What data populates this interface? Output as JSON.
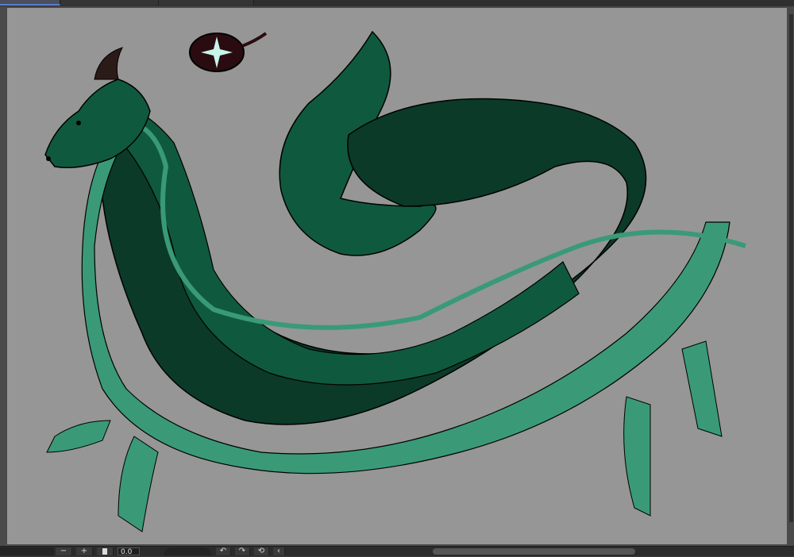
{
  "window": {
    "tabs": [
      {
        "label": "",
        "active": true
      },
      {
        "label": "",
        "active": false
      },
      {
        "label": "",
        "active": false
      }
    ]
  },
  "canvas": {
    "background_color": "#969696",
    "artwork": "dragon-illustration",
    "colors": {
      "body_dark": "#0b3a29",
      "body_mid": "#0f5a3e",
      "scales": "#3a9a78",
      "emblem": "#2a0c10",
      "sparkle": "#c8f4ea"
    }
  },
  "bottom_toolbar": {
    "zoom_out_label": "−",
    "zoom_in_label": "+",
    "zoom_value": "0.0",
    "icons": [
      "zoom-out-icon",
      "zoom-in-icon",
      "fit-icon",
      "rotate-left-icon",
      "rotate-right-icon",
      "reset-rotation-icon",
      "flip-icon"
    ]
  }
}
